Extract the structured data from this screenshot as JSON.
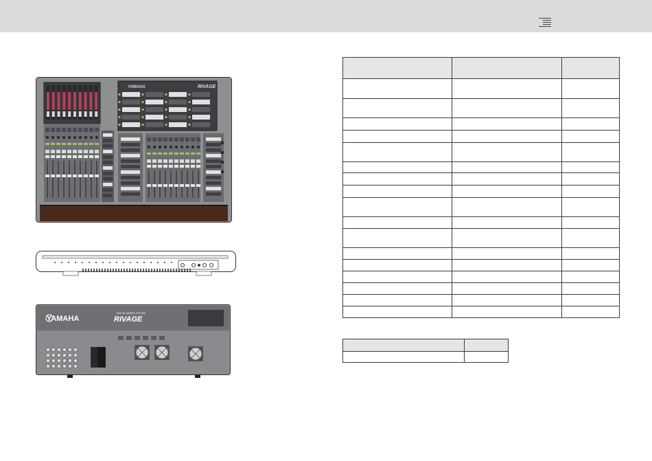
{
  "header": {
    "menu_icon": "hamburger-menu-icon",
    "background": "#dcdcdd"
  },
  "console_top": {
    "brand": "YAMAHA",
    "product": "RIVAGE",
    "wood_color": "#4a2a1c"
  },
  "console_rear": {
    "brand": "YAMAHA",
    "product": "RIVAGE",
    "series": "DIGITAL MIXING SYSTEM"
  },
  "spec_table": {
    "header_color": "#e6e6e6",
    "rows": 19
  },
  "small_table": {
    "rows": 1
  }
}
